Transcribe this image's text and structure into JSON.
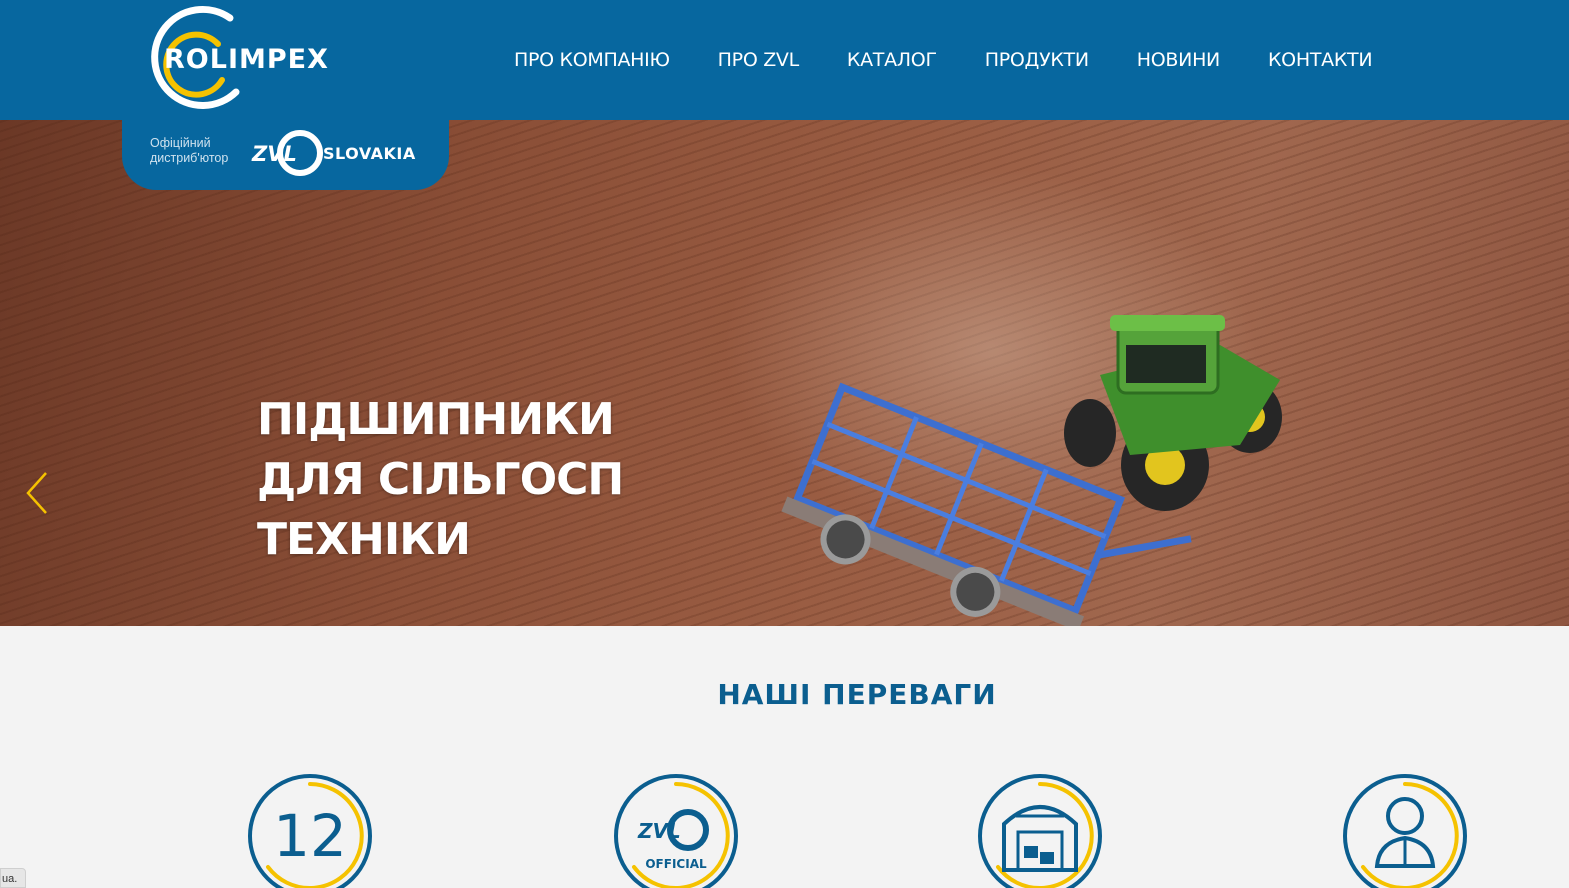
{
  "brand": {
    "name": "ROLIMPEX",
    "distributor_label": "Офіційний дистриб'ютор",
    "partner_short": "ZVL",
    "partner_name": "SLOVAKIA"
  },
  "nav": {
    "items": [
      {
        "label": "ПРО КОМПАНІЮ"
      },
      {
        "label": "ПРО ZVL"
      },
      {
        "label": "КАТАЛОГ"
      },
      {
        "label": "ПРОДУКТИ"
      },
      {
        "label": "НОВИНИ"
      },
      {
        "label": "КОНТАКТИ"
      }
    ]
  },
  "hero": {
    "title_lines": [
      "ПІДШИПНИКИ",
      "ДЛЯ СІЛЬГОСП",
      "ТЕХНІКИ"
    ],
    "slides": 3,
    "active_slide": 3
  },
  "advantages": {
    "title": "НАШІ ПЕРЕВАГИ",
    "items": [
      {
        "icon": "years-12-icon",
        "text": "12"
      },
      {
        "icon": "zvl-official-icon",
        "text": "OFFICIAL",
        "short": "ZVL"
      },
      {
        "icon": "warehouse-icon"
      },
      {
        "icon": "manager-icon"
      }
    ]
  },
  "status": {
    "corner_text": "ua."
  },
  "colors": {
    "primary": "#07679f",
    "accent": "#f5c200",
    "heading": "#0b5e8f",
    "background": "#f3f3f3"
  }
}
